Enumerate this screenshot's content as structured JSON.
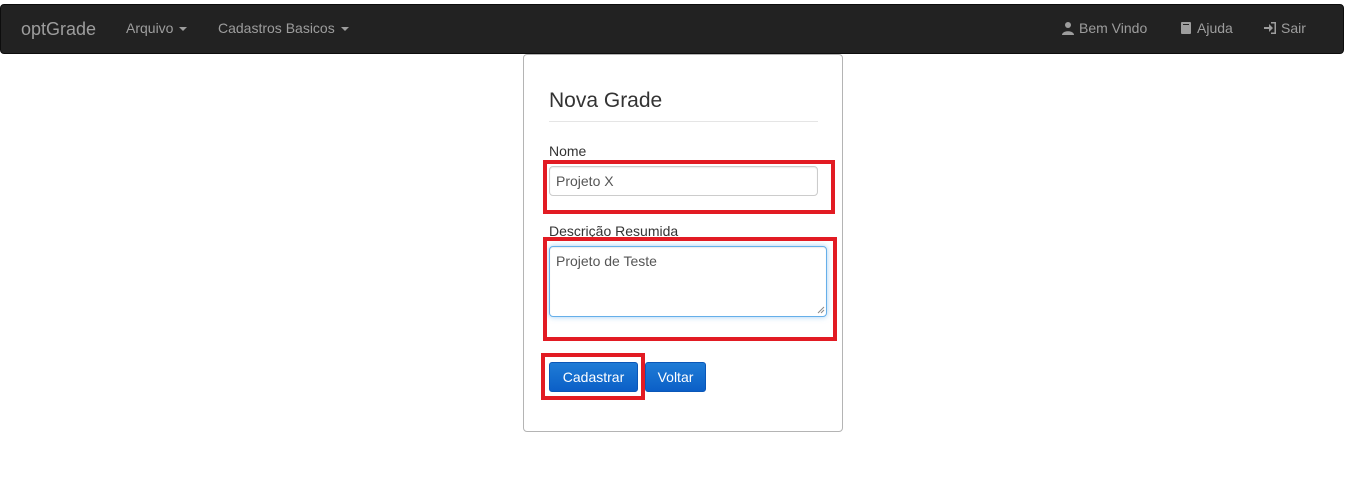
{
  "navbar": {
    "brand": "optGrade",
    "menus": [
      {
        "label": "Arquivo"
      },
      {
        "label": "Cadastros Basicos"
      }
    ],
    "right": [
      {
        "label": "Bem Vindo",
        "icon": "user-icon"
      },
      {
        "label": "Ajuda",
        "icon": "book-icon"
      },
      {
        "label": "Sair",
        "icon": "sign-out-icon"
      }
    ]
  },
  "form": {
    "legend": "Nova Grade",
    "nome_label": "Nome",
    "nome_value": "Projeto X",
    "descricao_label": "Descrição Resumida",
    "descricao_value": "Projeto de Teste",
    "submit_label": "Cadastrar",
    "back_label": "Voltar"
  },
  "colors": {
    "navbar_bg": "#222222",
    "nav_text": "#9d9d9d",
    "button_primary": "#0b5fc7",
    "highlight": "#e21b23"
  }
}
